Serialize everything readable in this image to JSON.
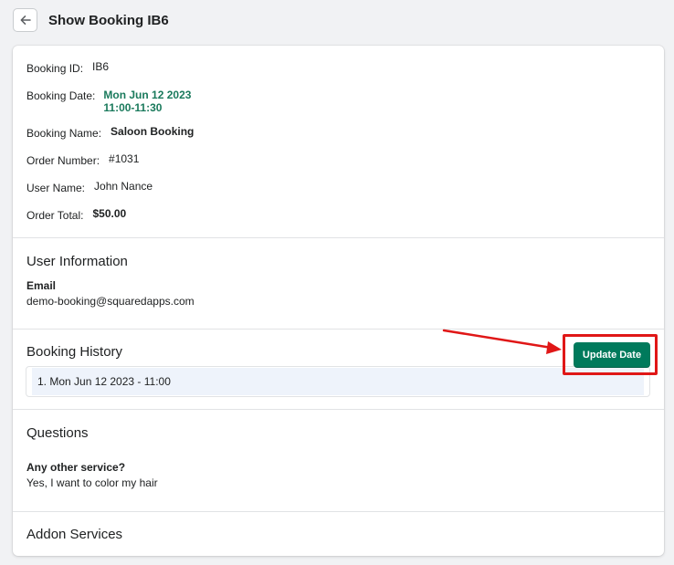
{
  "header": {
    "title": "Show Booking IB6",
    "back_icon": "arrow-left-icon"
  },
  "booking": {
    "id_label": "Booking ID:",
    "id_value": "IB6",
    "date_label": "Booking Date:",
    "date_line1": "Mon Jun 12 2023",
    "date_line2": "11:00-11:30",
    "name_label": "Booking Name:",
    "name_value": "Saloon Booking",
    "order_label": "Order Number:",
    "order_value": "#1031",
    "user_label": "User Name:",
    "user_value": "John Nance",
    "total_label": "Order Total:",
    "total_value": "$50.00"
  },
  "user_info": {
    "title": "User Information",
    "email_label": "Email",
    "email_value": "demo-booking@squaredapps.com"
  },
  "history": {
    "title": "Booking History",
    "items": [
      "1. Mon Jun 12 2023 - 11:00"
    ],
    "update_button": "Update Date"
  },
  "questions": {
    "title": "Questions",
    "q1": "Any other service?",
    "a1": "Yes, I want to color my hair"
  },
  "addons": {
    "title": "Addon Services"
  },
  "colors": {
    "accent": "#007a5c",
    "date_text": "#1a7a5c",
    "highlight": "#e01717"
  }
}
